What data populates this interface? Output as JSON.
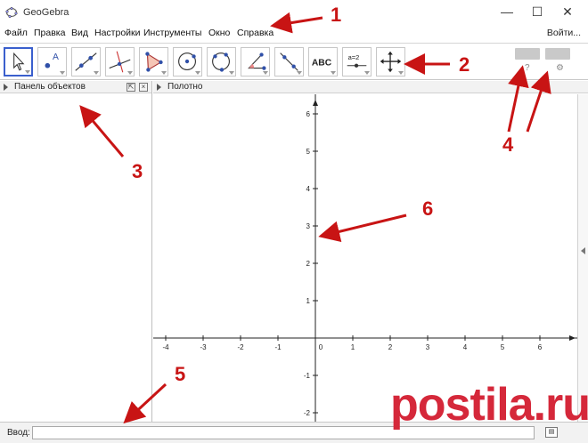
{
  "window": {
    "title": "GeoGebra",
    "minimize_glyph": "—",
    "maximize_glyph": "☐",
    "close_glyph": "✕"
  },
  "menu": {
    "items": [
      "Файл",
      "Правка",
      "Вид",
      "Настройки",
      "Инструменты",
      "Окно",
      "Справка"
    ],
    "signin": "Войти..."
  },
  "toolbar": {
    "tools": [
      {
        "name": "move-tool",
        "icon": "pointer-icon",
        "active": true
      },
      {
        "name": "point-tool",
        "icon": "point-icon",
        "label": "A"
      },
      {
        "name": "line-tool",
        "icon": "line-icon"
      },
      {
        "name": "perpendicular-tool",
        "icon": "perpendicular-icon"
      },
      {
        "name": "polygon-tool",
        "icon": "polygon-icon"
      },
      {
        "name": "circle-tool",
        "icon": "circle-center-icon"
      },
      {
        "name": "circle-3pt-tool",
        "icon": "circle-three-points-icon"
      },
      {
        "name": "angle-tool",
        "icon": "angle-icon"
      },
      {
        "name": "reflect-tool",
        "icon": "reflect-icon"
      },
      {
        "name": "text-tool",
        "icon": "text-icon",
        "label": "ABC"
      },
      {
        "name": "slider-tool",
        "icon": "slider-icon",
        "label": "a=2"
      },
      {
        "name": "move-view-tool",
        "icon": "move-graphics-icon"
      }
    ],
    "help_glyph": "?",
    "settings_glyph": "⚙"
  },
  "algebra_panel": {
    "title": "Панель объектов"
  },
  "graphics_panel": {
    "title": "Полотно",
    "x_ticks": [
      "-4",
      "-3",
      "-2",
      "-1",
      "0",
      "1",
      "2",
      "3",
      "4",
      "5",
      "6"
    ],
    "y_ticks": [
      "6",
      "5",
      "4",
      "3",
      "2",
      "1",
      "-1",
      "-2"
    ]
  },
  "input_bar": {
    "label": "Ввод:",
    "value": "",
    "placeholder": ""
  },
  "annotations": [
    "1",
    "2",
    "3",
    "4",
    "5",
    "6"
  ],
  "watermark": "postila.ru",
  "colors": {
    "annotation_red": "#c81414",
    "active_tool_border": "#3a5fcd",
    "watermark_red": "#d5283a"
  }
}
